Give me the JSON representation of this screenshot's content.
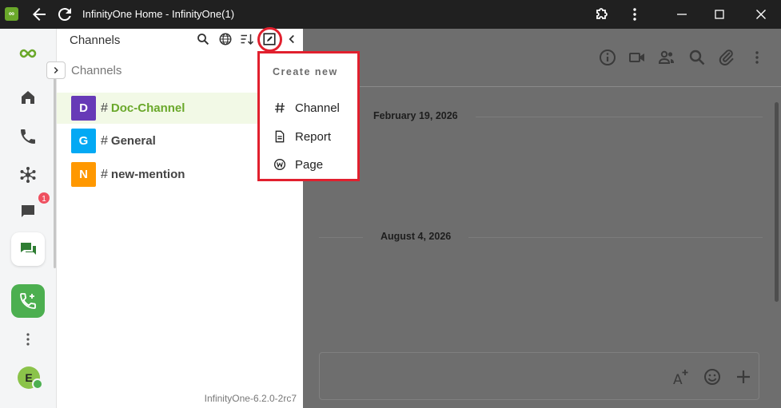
{
  "window": {
    "title": "InfinityOne Home - InfinityOne(1)",
    "app_icon_text": "∞"
  },
  "rail": {
    "notification_badge": "1",
    "user_initial": "E"
  },
  "sidebar": {
    "header_title": "Channels",
    "section_title": "Channels",
    "channels": [
      {
        "initial": "D",
        "name": "Doc-Channel",
        "color": "#673ab7",
        "active": true
      },
      {
        "initial": "G",
        "name": "General",
        "color": "#03a9f4",
        "active": false
      },
      {
        "initial": "N",
        "name": "new-mention",
        "color": "#ff9800",
        "active": false
      }
    ],
    "version": "InfinityOne-6.2.0-2rc7"
  },
  "main": {
    "dates": [
      "February 19, 2026",
      "August 4, 2026"
    ]
  },
  "create_menu": {
    "title": "Create new",
    "items": [
      {
        "icon": "hash-icon",
        "label": "Channel"
      },
      {
        "icon": "report-icon",
        "label": "Report"
      },
      {
        "icon": "page-icon",
        "label": "Page"
      }
    ]
  },
  "colors": {
    "accent": "#6aa82a",
    "highlight": "#e1202e",
    "badge": "#ef4f5f"
  }
}
